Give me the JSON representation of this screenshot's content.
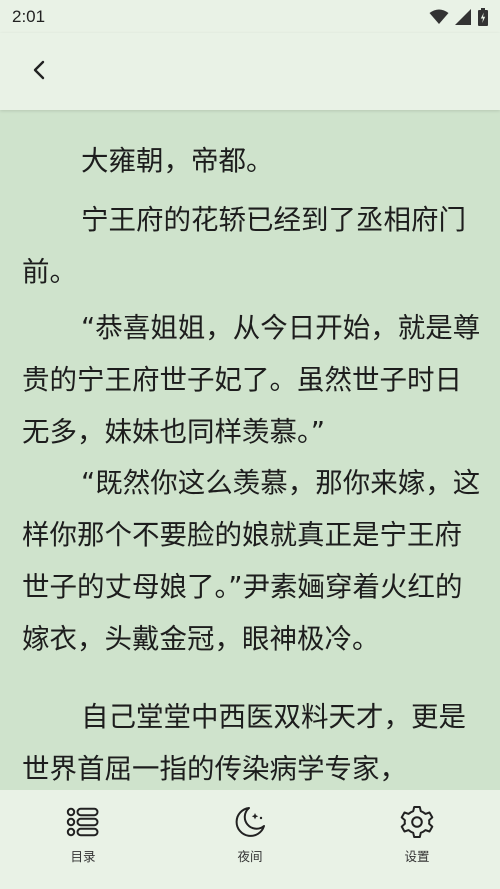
{
  "status_bar": {
    "time": "2:01",
    "icons": [
      "wifi-icon",
      "cellular-signal-icon",
      "battery-charging-icon"
    ]
  },
  "header": {
    "back_icon": "chevron-left-icon"
  },
  "reader": {
    "paragraphs": [
      "大雍朝，帝都。",
      "宁王府的花轿已经到了丞相府门前。",
      "“恭喜姐姐，从今日开始，就是尊贵的宁王府世子妃了。虽然世子时日无多，妹妹也同样羡慕。”",
      "“既然你这么羡慕，那你来嫁，这样你那个不要脸的娘就真正是宁王府世子的丈母娘了。”尹素婳穿着火红的嫁衣，头戴金冠，眼神极冷。",
      "自己堂堂中西医双料天才，更是世界首屈一指的传染病学专家，"
    ]
  },
  "bottom_nav": {
    "items": [
      {
        "label": "目录",
        "icon": "list-icon"
      },
      {
        "label": "夜间",
        "icon": "moon-icon"
      },
      {
        "label": "设置",
        "icon": "gear-icon"
      }
    ]
  },
  "colors": {
    "page_background": "#cfe3cc",
    "bar_background": "#e9f2e6",
    "text": "#1d1d1d"
  }
}
